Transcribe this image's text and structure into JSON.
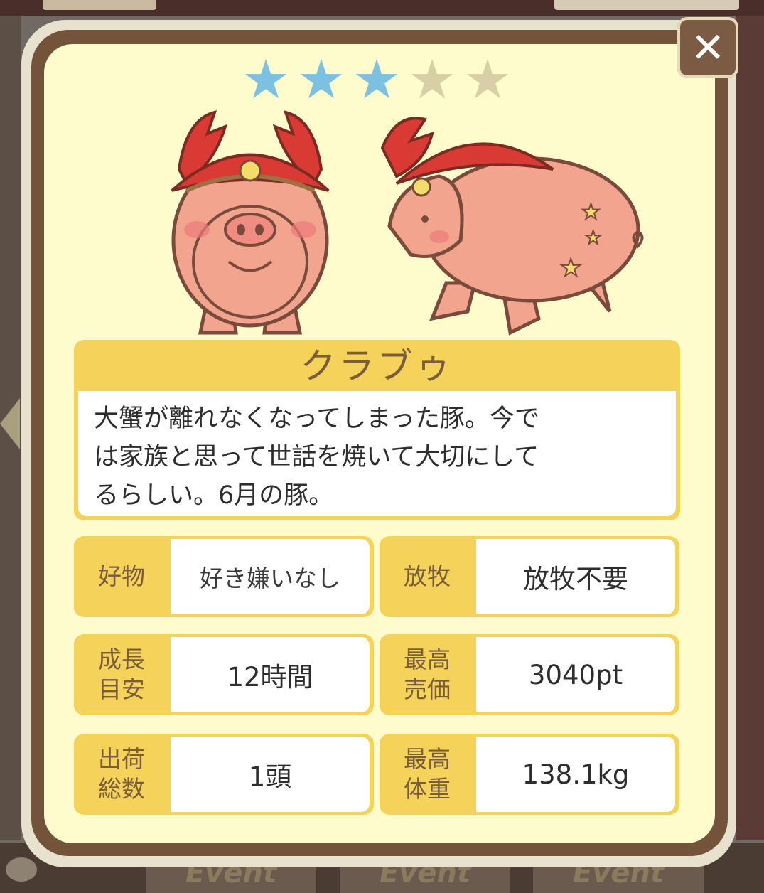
{
  "background": {
    "tabs": [
      "Event",
      "Event",
      "Event"
    ]
  },
  "dialog": {
    "close_icon": "close-icon",
    "rating": {
      "value": 3,
      "max": 5
    },
    "pig_name": "クラブゥ",
    "description_lines": [
      "大蟹が離れなくなってしまった豚。今で",
      "は家族と思って世話を焼いて大切にして",
      "るらしい。6月の豚。"
    ],
    "stats": {
      "favorite": {
        "label": "好物",
        "value": "好き嫌いなし"
      },
      "grazing": {
        "label": "放牧",
        "value": "放牧不要"
      },
      "growth": {
        "label_lines": [
          "成長",
          "目安"
        ],
        "value": "12時間"
      },
      "max_price": {
        "label_lines": [
          "最高",
          "売価"
        ],
        "value": "3040pt"
      },
      "shipped": {
        "label_lines": [
          "出荷",
          "総数"
        ],
        "value": "1頭"
      },
      "max_weight": {
        "label_lines": [
          "最高",
          "体重"
        ],
        "value": "138.1kg"
      }
    }
  },
  "colors": {
    "panel_bg": "#fefbcd",
    "frame": "#74533b",
    "label_bg": "#f5d25a",
    "star_on": "#7cc0e2",
    "star_off": "#d8cfa6"
  }
}
